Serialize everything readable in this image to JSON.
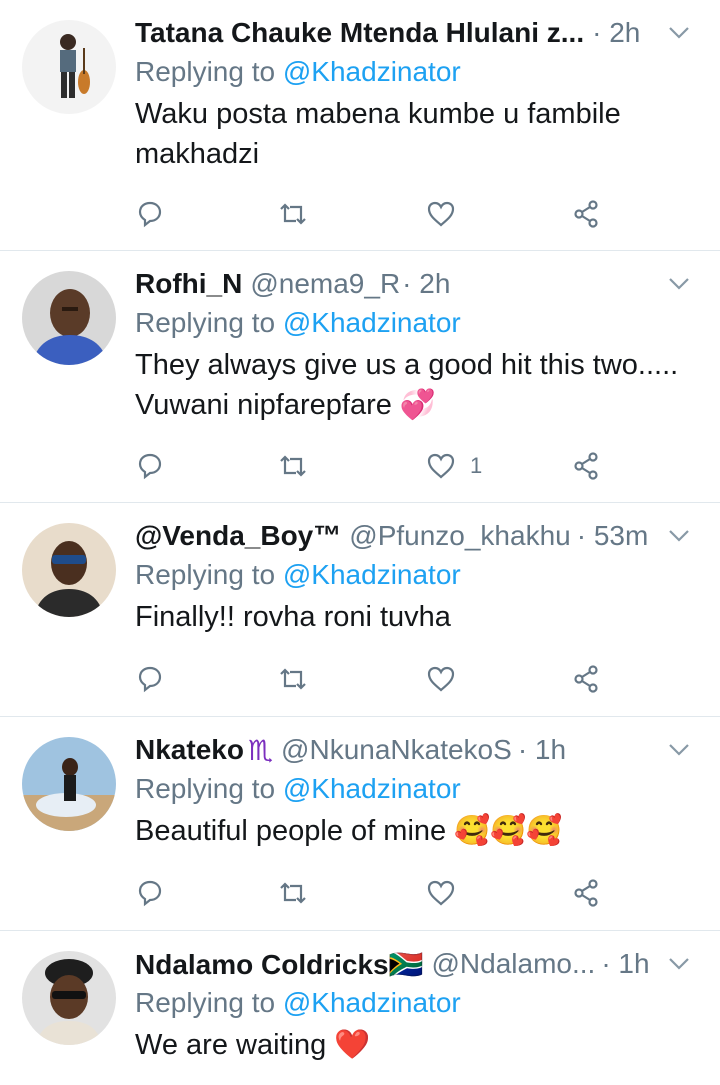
{
  "tweets": [
    {
      "name": "Tatana Chauke Mtenda Hlulani z...",
      "badge": "",
      "handle": "",
      "time": "· 2h",
      "replying_prefix": "Replying to",
      "replying_to": "@Khadzinator",
      "text": "Waku posta mabena kumbe u fambile makhadzi",
      "like_count": ""
    },
    {
      "name": "Rofhi_N",
      "badge": "",
      "handle": "@nema9_R",
      "time": "· 2h",
      "replying_prefix": "Replying to",
      "replying_to": "@Khadzinator",
      "text": "They always give us a good hit this two..... Vuwani nipfarepfare 💞",
      "like_count": "1"
    },
    {
      "name": "@Venda_Boy™",
      "badge": "",
      "handle": "@Pfunzo_khakhu",
      "time": "· 53m",
      "replying_prefix": "Replying to",
      "replying_to": "@Khadzinator",
      "text": "Finally!! rovha roni tuvha",
      "like_count": ""
    },
    {
      "name": "Nkateko",
      "badge": "♏",
      "handle": "@NkunaNkatekoS",
      "time": "· 1h",
      "replying_prefix": "Replying to",
      "replying_to": "@Khadzinator",
      "text": "Beautiful people of mine 🥰🥰🥰",
      "like_count": ""
    },
    {
      "name": "Ndalamo Coldricks🇿🇦",
      "badge": "",
      "handle": "@Ndalamo...",
      "time": "· 1h",
      "replying_prefix": "Replying to",
      "replying_to": "@Khadzinator",
      "text": "We are waiting ❤️",
      "like_count": ""
    }
  ],
  "icons": {
    "reply": "reply-icon",
    "retweet": "retweet-icon",
    "like": "like-icon",
    "share": "share-icon",
    "caret": "chevron-down-icon"
  },
  "colors": {
    "text": "#14171a",
    "secondary": "#657786",
    "link": "#1da1f2",
    "divider": "#e1e8ed"
  }
}
